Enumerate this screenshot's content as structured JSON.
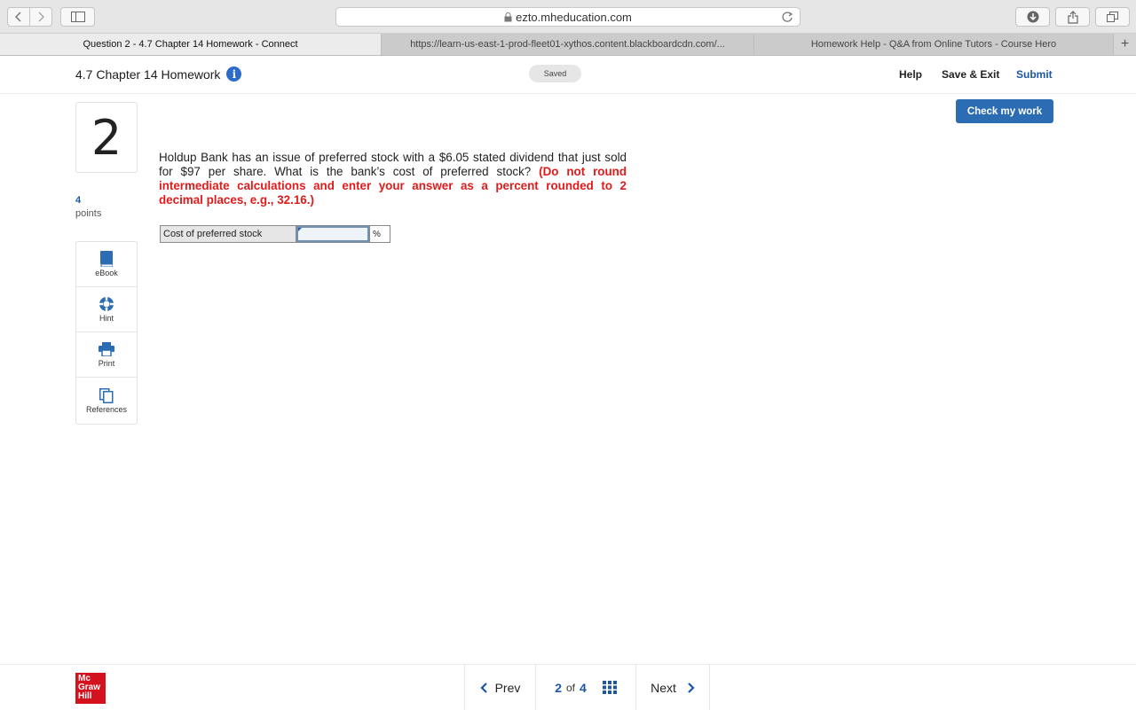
{
  "browser": {
    "url": "ezto.mheducation.com",
    "tabs": [
      {
        "title": "Question 2 - 4.7 Chapter 14 Homework - Connect"
      },
      {
        "title": "https://learn-us-east-1-prod-fleet01-xythos.content.blackboardcdn.com/..."
      },
      {
        "title": "Homework Help - Q&A from Online Tutors - Course Hero"
      }
    ],
    "new_tab": "+"
  },
  "header": {
    "title": "4.7 Chapter 14 Homework",
    "info_icon": "i",
    "status": "Saved",
    "help": "Help",
    "save_exit": "Save & Exit",
    "submit": "Submit"
  },
  "question": {
    "number": "2",
    "points": "4",
    "points_label": "points",
    "text": "Holdup Bank has an issue of preferred stock with a $6.05 stated dividend that just sold for $97 per share. What is the bank’s cost of preferred stock? ",
    "instruction": "(Do not round intermediate calculations and enter your answer as a percent rounded to 2 decimal places, e.g., 32.16.)",
    "answer_label": "Cost of preferred stock",
    "answer_value": "",
    "answer_unit": "%"
  },
  "tools": [
    {
      "label": "eBook",
      "icon": "book-icon"
    },
    {
      "label": "Hint",
      "icon": "lifebuoy-icon"
    },
    {
      "label": "Print",
      "icon": "printer-icon"
    },
    {
      "label": "References",
      "icon": "documents-icon"
    }
  ],
  "check_button": "Check my work",
  "footer": {
    "logo_lines": [
      "Mc",
      "Graw",
      "Hill"
    ],
    "prev": "Prev",
    "current": "2",
    "of": "of",
    "total": "4",
    "next": "Next"
  },
  "colors": {
    "accent": "#1b57a6",
    "button": "#2b6cb3",
    "warning": "#e01b1b",
    "brand": "#d3121d"
  }
}
